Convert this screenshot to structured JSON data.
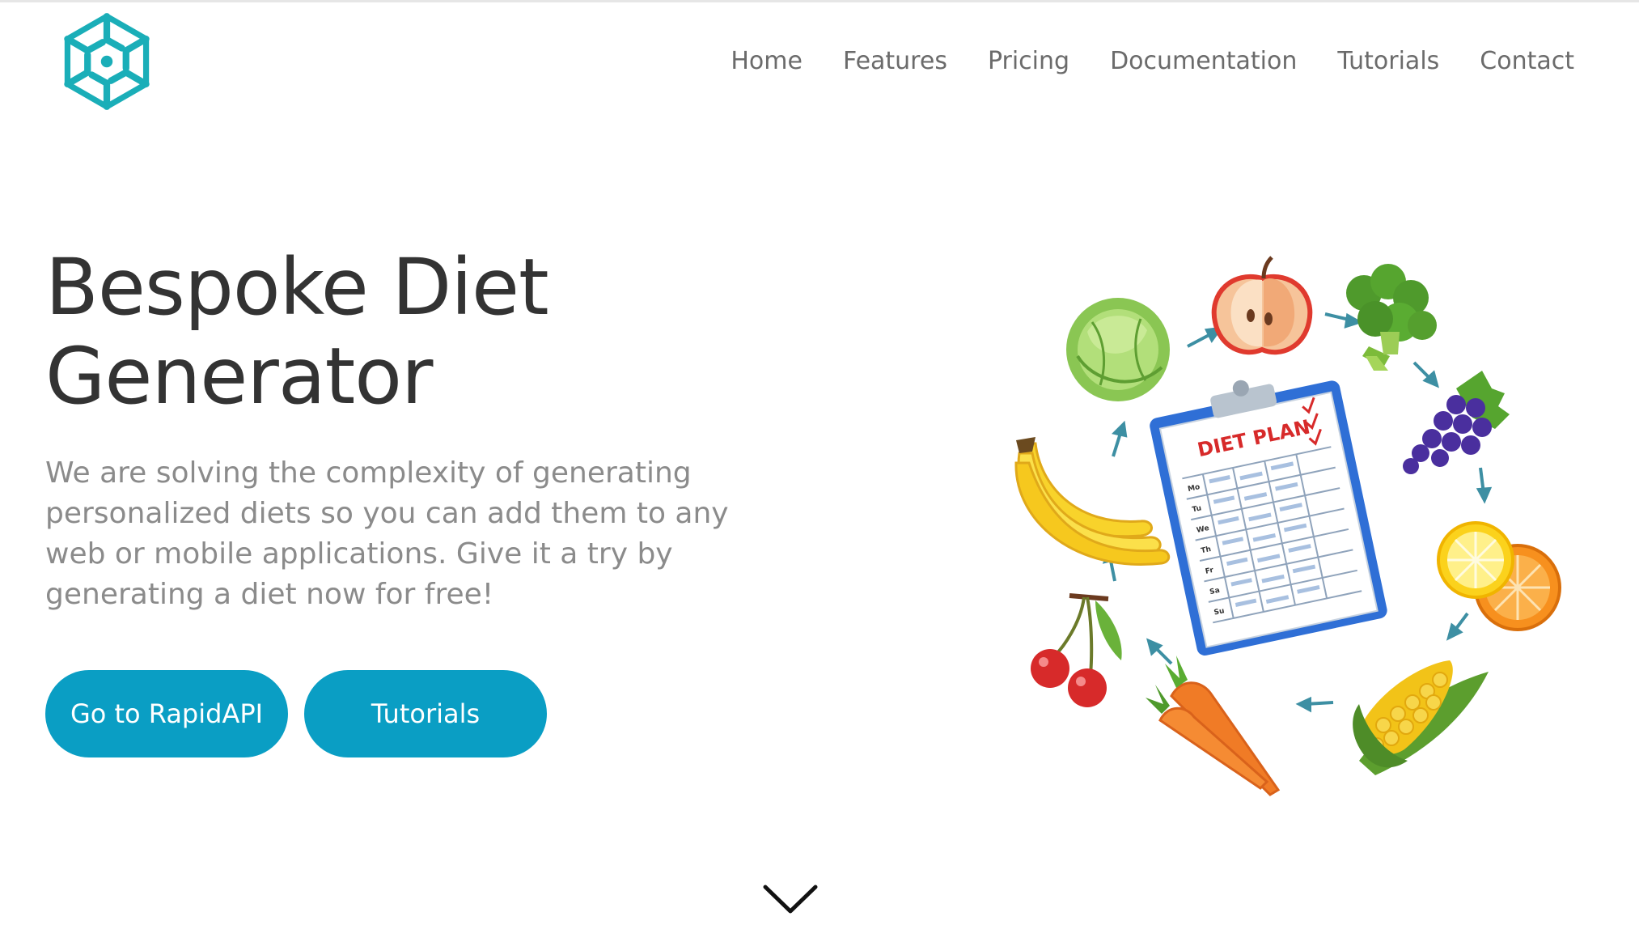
{
  "nav": {
    "items": [
      "Home",
      "Features",
      "Pricing",
      "Documentation",
      "Tutorials",
      "Contact"
    ]
  },
  "hero": {
    "title_line1": "Bespoke Diet",
    "title_line2": "Generator",
    "description": "We are solving the complexity of generating personalized diets so you can add them to any web or mobile applications. Give it a try by generating a diet now for free!",
    "primary_button": "Go to RapidAPI",
    "secondary_button": "Tutorials"
  },
  "illustration": {
    "clipboard_title": "DIET PLAN",
    "day_labels": [
      "Mo",
      "Tu",
      "We",
      "Th",
      "Fr",
      "Sa",
      "Su"
    ]
  },
  "icons": {
    "logo": "hexagon-circuit-logo",
    "scroll": "chevron-down-icon"
  },
  "colors": {
    "brand_teal": "#1aaeb8",
    "button_blue": "#0a9ec4",
    "title_dark": "#333333",
    "nav_gray": "#6b6b6b",
    "body_gray": "#8b8b8b"
  }
}
